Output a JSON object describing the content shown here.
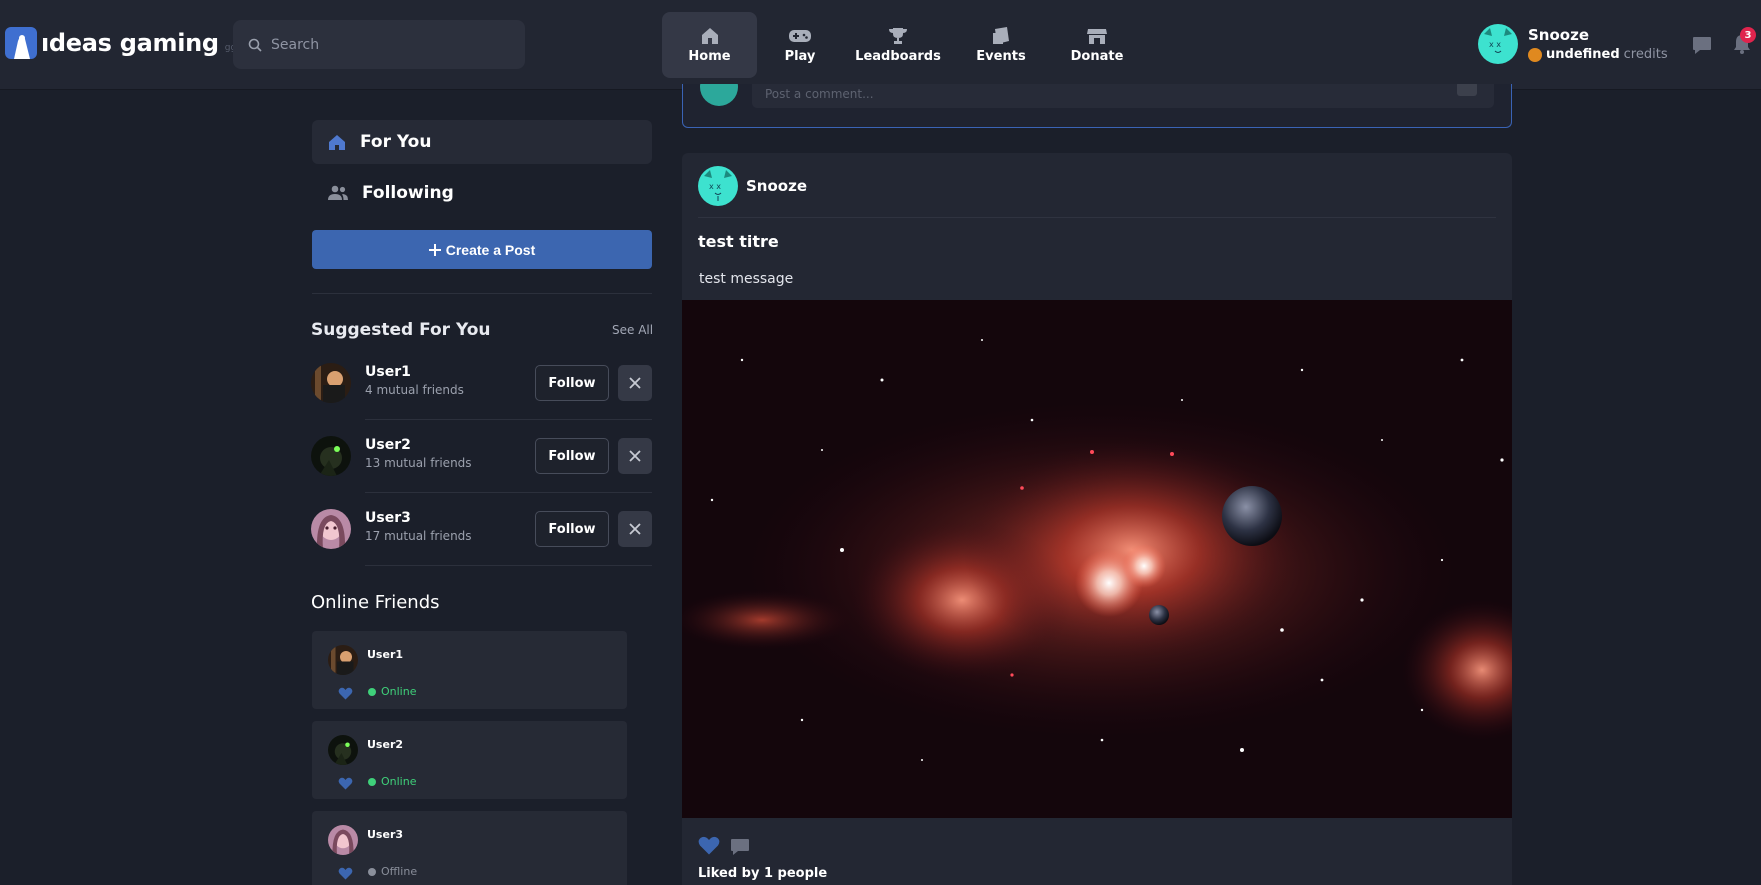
{
  "app": {
    "logo_text": "ıdeas gaming",
    "logo_sub": "gg"
  },
  "search": {
    "placeholder": "Search"
  },
  "nav": [
    {
      "label": "Home",
      "icon": "home-icon",
      "active": true
    },
    {
      "label": "Play",
      "icon": "gamepad-icon"
    },
    {
      "label": "Leadboards",
      "icon": "trophy-icon"
    },
    {
      "label": "Events",
      "icon": "ticket-icon"
    },
    {
      "label": "Donate",
      "icon": "store-icon"
    }
  ],
  "user": {
    "name": "Snooze",
    "credits_value": "undefined",
    "credits_label": "credits"
  },
  "notifications": {
    "count": "3"
  },
  "sidebar": {
    "for_you": "For You",
    "following": "Following",
    "create_post": "Create a Post"
  },
  "suggested": {
    "title": "Suggested For You",
    "see_all": "See All",
    "follow_label": "Follow",
    "users": [
      {
        "name": "User1",
        "mutual": "4 mutual friends"
      },
      {
        "name": "User2",
        "mutual": "13 mutual friends"
      },
      {
        "name": "User3",
        "mutual": "17 mutual friends"
      }
    ]
  },
  "online": {
    "title": "Online Friends",
    "friends": [
      {
        "name": "User1",
        "status": "Online"
      },
      {
        "name": "User2",
        "status": "Online"
      },
      {
        "name": "User3",
        "status": "Offline"
      }
    ]
  },
  "composer": {
    "placeholder": "Post a comment..."
  },
  "post": {
    "author": "Snooze",
    "title": "test titre",
    "message": "test message",
    "liked_by": "Liked by 1 people"
  },
  "colors": {
    "accent": "#3c66b0",
    "online": "#3fd07a",
    "offline": "#8a8f9b",
    "badge": "#e0244d",
    "avatar": "#3de2cf"
  }
}
